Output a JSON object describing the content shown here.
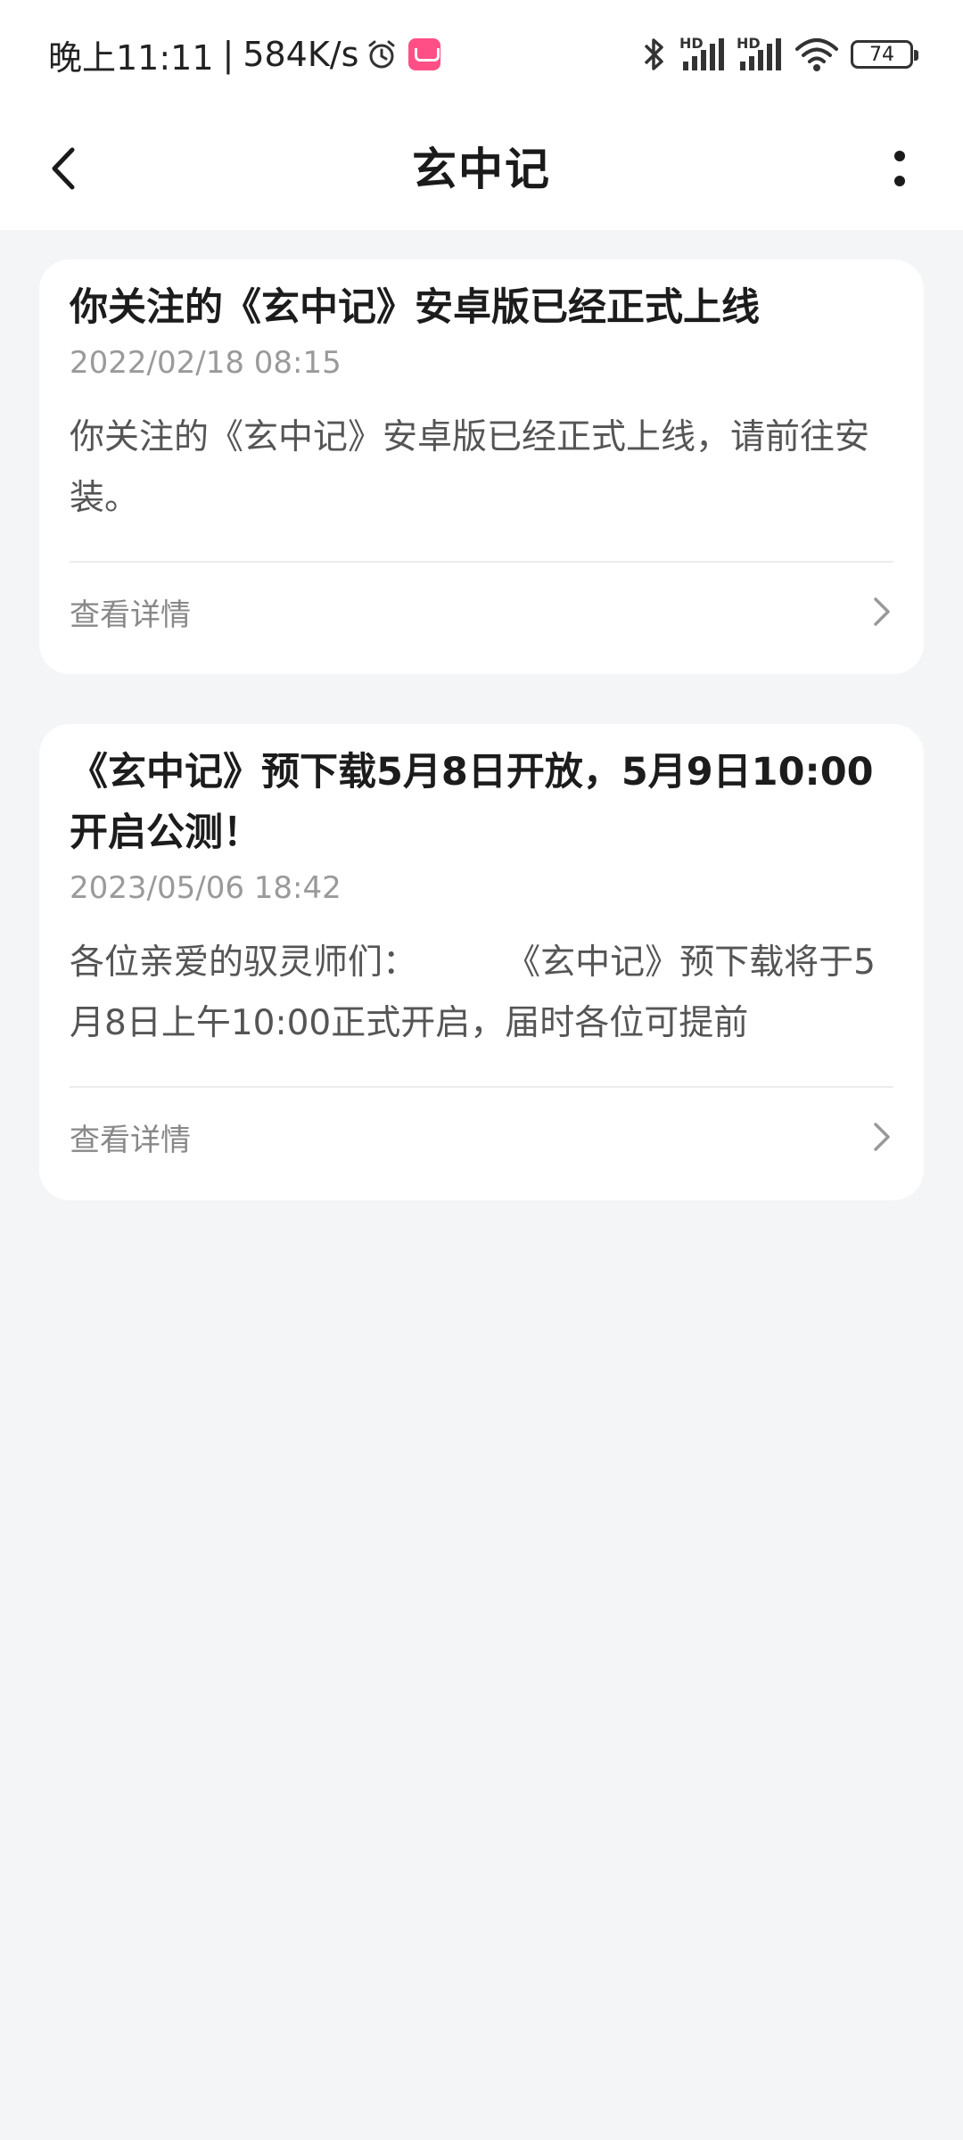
{
  "status_bar": {
    "time": "晚上11:11",
    "separator": "|",
    "network_speed": "584K/s",
    "icons": [
      "alarm-icon",
      "app-badge-icon",
      "bluetooth-icon",
      "signal-hd-icon",
      "signal-hd-icon",
      "wifi-icon",
      "battery-icon"
    ],
    "hd_label_1": "HD",
    "hd_label_2": "HD",
    "battery_level": "74"
  },
  "header": {
    "title": "玄中记",
    "back_icon": "chevron-left-icon",
    "more_icon": "more-vertical-icon"
  },
  "notices": [
    {
      "title": "你关注的《玄中记》安卓版已经正式上线",
      "date": "2022/02/18 08:15",
      "body": "你关注的《玄中记》安卓版已经正式上线，请前往安装。",
      "link_label": "查看详情"
    },
    {
      "title": "《玄中记》预下载5月8日开放，5月9日10:00开启公测！",
      "date": "2023/05/06 18:42",
      "body": "各位亲爱的驭灵师们：        《玄中记》预下载将于5月8日上午10:00正式开启，届时各位可提前",
      "link_label": "查看详情"
    }
  ],
  "colors": {
    "page_background": "#f4f5f7",
    "card_background": "#ffffff",
    "title_text": "#1c1c1c",
    "meta_text": "#9a9a9a",
    "body_text": "#555555",
    "accent_badge": "#ff4f86"
  }
}
